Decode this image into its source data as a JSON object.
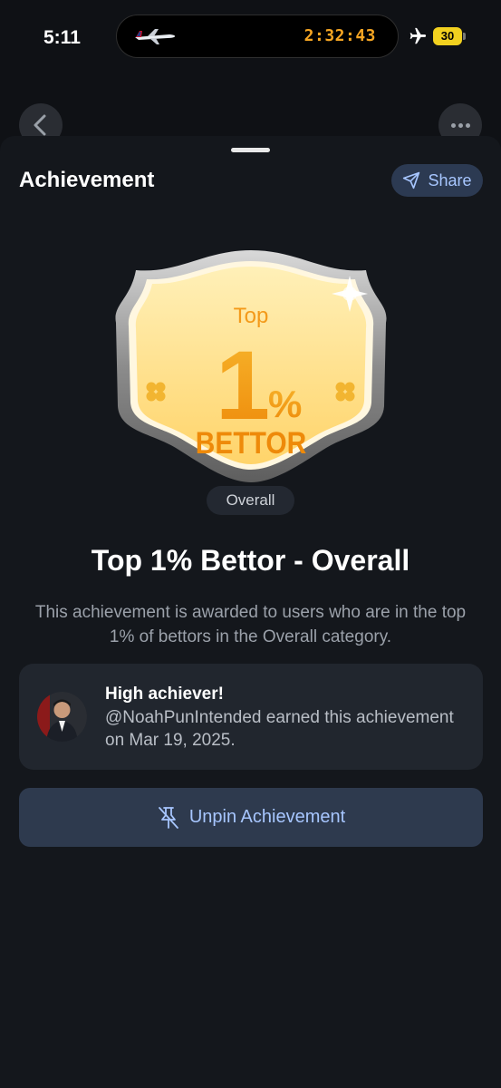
{
  "status_bar": {
    "time": "5:11",
    "live_activity_timer": "2:32:43",
    "battery_level": "30"
  },
  "sheet": {
    "title": "Achievement",
    "share_label": "Share"
  },
  "badge": {
    "top_text": "Top",
    "number": "1",
    "percent_sign": "%",
    "bottom_text": "BETTOR",
    "category": "Overall"
  },
  "achievement": {
    "title": "Top 1% Bettor - Overall",
    "description": "This achievement is awarded to users who are in the top 1% of bettors in the Overall category."
  },
  "earner_card": {
    "heading": "High achiever!",
    "text": "@NoahPunIntended earned this achievement on Mar 19, 2025."
  },
  "actions": {
    "unpin_label": "Unpin Achievement"
  },
  "colors": {
    "background": "#0f1115",
    "sheet": "#14171c",
    "accent_text": "#a7c6ff",
    "badge_gold": "#f39a1a",
    "timer_orange": "#f6a623"
  }
}
